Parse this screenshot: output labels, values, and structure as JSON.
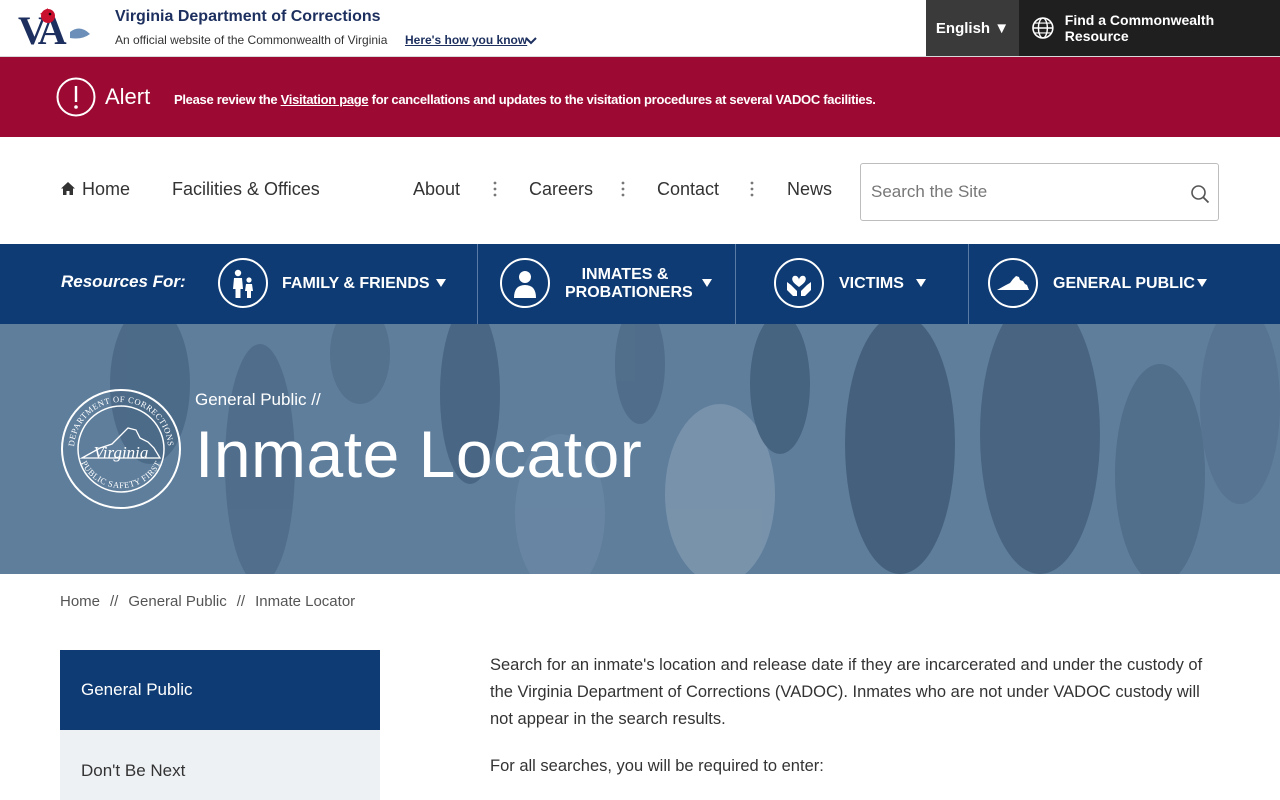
{
  "header": {
    "logo_text": "VA",
    "site_title": "Virginia Department of Corrections",
    "site_subtitle": "An official website of the Commonwealth of Virginia",
    "how_you_know": "Here's how you know",
    "language": "English ▼",
    "find_resource": "Find a Commonwealth Resource"
  },
  "alert": {
    "title": "Alert",
    "message_prefix": "Please review the ",
    "link_text": "Visitation page",
    "message_suffix": " for cancellations and updates to the visitation procedures at several VADOC facilities."
  },
  "nav": {
    "home": "Home",
    "facilities": "Facilities & Offices",
    "about": "About",
    "careers": "Careers",
    "contact": "Contact",
    "news": "News",
    "search_placeholder": "Search the Site"
  },
  "resources": {
    "label": "Resources For:",
    "items": [
      {
        "label": "FAMILY & FRIENDS",
        "icon": "family-icon"
      },
      {
        "label": "INMATES &",
        "label2": "PROBATIONERS",
        "icon": "person-icon"
      },
      {
        "label": "VICTIMS",
        "icon": "heart-hands-icon"
      },
      {
        "label": "GENERAL PUBLIC",
        "icon": "virginia-map-icon"
      }
    ]
  },
  "hero": {
    "crumb": "General Public  //",
    "title": "Inmate Locator",
    "seal_text_top": "DEPARTMENT OF CORRECTIONS",
    "seal_text_bottom": "PUBLIC SAFETY FIRST",
    "seal_center": "Virginia"
  },
  "breadcrumb": {
    "items": [
      "Home",
      "General Public",
      "Inmate Locator"
    ],
    "separator": "//"
  },
  "sidebar": {
    "heading": "General Public",
    "items": [
      "Don't Be Next"
    ]
  },
  "content": {
    "paragraphs": [
      "Search for an inmate's location and release date if they are incarcerated and under the custody of the Virginia Department of Corrections (VADOC). Inmates who are not under VADOC custody will not appear in the search results.",
      "For all searches, you will be required to enter:"
    ]
  },
  "colors": {
    "alert_bg": "#9c0a33",
    "nav_blue": "#0e3b73",
    "title_navy": "#1c2f5e"
  }
}
